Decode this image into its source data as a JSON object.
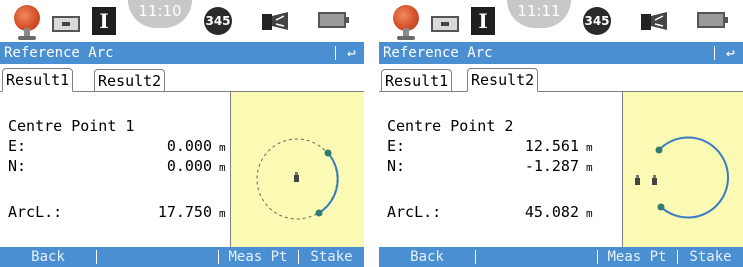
{
  "screens": [
    {
      "status": {
        "mode_letter": "I",
        "time": "11:10",
        "satellites": "345"
      },
      "title": "Reference Arc",
      "back_icon": "↩",
      "tabs": [
        "Result1",
        "Result2"
      ],
      "active_tab": 0,
      "heading": "Centre Point 1",
      "fields": {
        "e": {
          "label": "E:",
          "value": "0.000",
          "unit": "m"
        },
        "n": {
          "label": "N:",
          "value": "0.000",
          "unit": "m"
        },
        "arcl": {
          "label": "ArcL.:",
          "value": "17.750",
          "unit": "m"
        }
      },
      "softkeys": {
        "back": "Back",
        "meas_pt": "Meas Pt",
        "stake": "Stake"
      },
      "icons": [
        "prism-icon",
        "memory-card-icon",
        "mode-icon",
        "time-indicator",
        "satellites-icon",
        "sensor-icon",
        "battery-icon",
        "back-arrow-icon",
        "centre-point-icon"
      ]
    },
    {
      "status": {
        "mode_letter": "I",
        "time": "11:11",
        "satellites": "345"
      },
      "title": "Reference Arc",
      "back_icon": "↩",
      "tabs": [
        "Result1",
        "Result2"
      ],
      "active_tab": 1,
      "heading": "Centre Point 2",
      "fields": {
        "e": {
          "label": "E:",
          "value": "12.561",
          "unit": "m"
        },
        "n": {
          "label": "N:",
          "value": "-1.287",
          "unit": "m"
        },
        "arcl": {
          "label": "ArcL.:",
          "value": "45.082",
          "unit": "m"
        }
      },
      "softkeys": {
        "back": "Back",
        "meas_pt": "Meas Pt",
        "stake": "Stake"
      },
      "icons": [
        "prism-icon",
        "memory-card-icon",
        "mode-icon",
        "time-indicator",
        "satellites-icon",
        "sensor-icon",
        "battery-icon",
        "back-arrow-icon",
        "centre-point-icon",
        "point-icon"
      ]
    }
  ],
  "colors": {
    "title_bar": "#4a8fd1",
    "graphic_bg": "#fafab4",
    "arc": "#3a7cc4",
    "arc_point": "#2e7d6e"
  }
}
